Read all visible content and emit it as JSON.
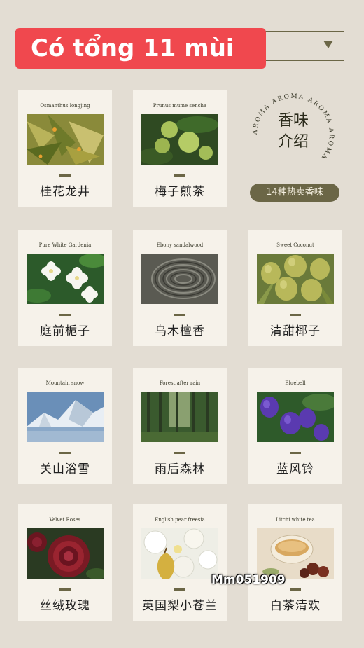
{
  "header": {
    "title": "Có tổng 11 mùi"
  },
  "aroma": {
    "ring_text": "AROMA AROMA AROMA AROMA",
    "title_line1": "香味",
    "title_line2": "介绍",
    "badge": "14种热卖香味"
  },
  "cards": [
    {
      "en": "Osmanthus longjing",
      "cn": "桂花龙井",
      "image": "tea-leaves"
    },
    {
      "en": "Prunus mume sencha",
      "cn": "梅子煎茶",
      "image": "green-plums"
    },
    {
      "en": "Pure White Gardenia",
      "cn": "庭前栀子",
      "image": "gardenia"
    },
    {
      "en": "Ebony sandalwood",
      "cn": "乌木檀香",
      "image": "wood-grain"
    },
    {
      "en": "Sweet Coconut",
      "cn": "清甜椰子",
      "image": "coconuts"
    },
    {
      "en": "Mountain snow",
      "cn": "关山浴雪",
      "image": "snow-mountain"
    },
    {
      "en": "Forest after rain",
      "cn": "雨后森林",
      "image": "forest"
    },
    {
      "en": "Bluebell",
      "cn": "蓝风铃",
      "image": "bluebell"
    },
    {
      "en": "Velvet Roses",
      "cn": "丝绒玫瑰",
      "image": "roses"
    },
    {
      "en": "English pear freesia",
      "cn": "英国梨小苍兰",
      "image": "pear-freesia"
    },
    {
      "en": "Litchi white tea",
      "cn": "白茶清欢",
      "image": "white-tea"
    }
  ],
  "watermark": "Mm051909",
  "colors": {
    "banner": "#f0484e",
    "accent": "#6b6646",
    "background": "#e3ddd3",
    "card": "#f6f2ea"
  }
}
